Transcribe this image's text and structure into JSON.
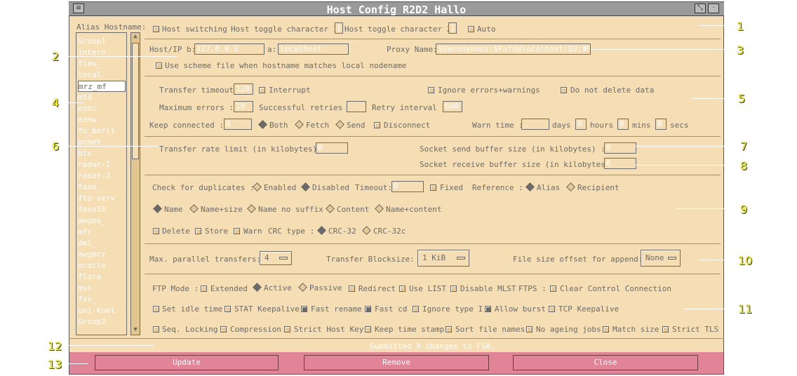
{
  "window": {
    "title": "Host Config R2D2 Hallo"
  },
  "sidebar": {
    "header": "Alias Hostname:",
    "items": [
      "Group1",
      "intern",
      "fiau_",
      "local",
      "mrz_mf",
      "mfd",
      "esoc",
      "ezmw",
      "fu_berl1",
      "pcmet_",
      "btx",
      "radar-1",
      "radar-2",
      "faxe_",
      "ftp-serv",
      "faxe10",
      "awgeo_",
      "mfc",
      "dmi_",
      "awgmrz",
      "oracle",
      "flora",
      "mss",
      "fss_",
      "uni-koel",
      "Group2"
    ],
    "selected_index": 4
  },
  "row1": {
    "host_switching": "Host switching",
    "toggle1_label": "Host toggle character 1:",
    "toggle1_value": "[",
    "toggle2_label": "Host toggle character 2:",
    "toggle2_value": "]",
    "auto": "Auto"
  },
  "row2": {
    "hostip_label": "Host/IP b:",
    "hostip_b": "127.0.0.1",
    "a_label": "a:",
    "hostip_a": "localhost",
    "proxy_label": "Proxy Name:",
    "proxy_value": "$Uanonymous;$Pafd@localhost;$U;$P",
    "scheme_file": "Use scheme file when hostname matches local nodename"
  },
  "transfer": {
    "timeout_label": "Transfer timeout:",
    "timeout_value": "120",
    "interrupt": "Interrupt",
    "ignore_errors": "Ignore errors+warnings",
    "no_delete": "Do not delete data",
    "max_errors_label": "Maximum errors  :",
    "max_errors_value": "10",
    "retries_label": "Successful retries :",
    "retries_value": "",
    "retry_interval_label": "Retry interval :",
    "retry_interval_value": "600",
    "keep_label": "Keep connected  :",
    "keep_value": "0",
    "both": "Both",
    "fetch": "Fetch",
    "send": "Send",
    "disconnect": "Disconnect",
    "warn_label": "Warn time :",
    "warn_days": "",
    "days": "days",
    "warn_hours": "0",
    "hours": "hours",
    "warn_mins": "0",
    "mins": "mins",
    "warn_secs": "0",
    "secs": "secs"
  },
  "rate": {
    "limit_label": "Transfer rate limit (in kilobytes) :",
    "limit_value": "0",
    "send_buf_label": "Socket send buffer size (in kilobytes)    :",
    "send_buf_value": "0",
    "recv_buf_label": "Socket receive buffer size (in kilobytes) :",
    "recv_buf_value": "0"
  },
  "dup": {
    "check_label": "Check for duplicates :",
    "enabled": "Enabled",
    "disabled": "Disabled",
    "timeout_label": "Timeout:",
    "timeout_value": "0",
    "fixed": "Fixed",
    "reference_label": "Reference :",
    "alias": "Alias",
    "recipient": "Recipient",
    "name": "Name",
    "name_size": "Name+size",
    "name_no_suffix": "Name no suffix",
    "content": "Content",
    "name_content": "Name+content",
    "delete": "Delete",
    "store": "Store",
    "warn": "Warn",
    "crc_label": "CRC type :",
    "crc32": "CRC-32",
    "crc32c": "CRC-32c"
  },
  "par": {
    "max_label": "Max. parallel transfers:",
    "max_value": "4",
    "blocksize_label": "Transfer Blocksize:",
    "blocksize_value": "1 KiB",
    "offset_label": "File size offset for append:",
    "offset_value": "None"
  },
  "ftp": {
    "mode_label": "FTP Mode :",
    "extended": "Extended",
    "active": "Active",
    "passive": "Passive",
    "redirect": "Redirect",
    "use_list": "Use LIST",
    "disable_mlst": "Disable MLST",
    "ftps_label": "FTPS :",
    "clear_control": "Clear Control Connection",
    "idle": "Set idle time",
    "stat_keepalive": "STAT Keepalive",
    "fast_rename": "Fast rename",
    "fast_cd": "Fast cd",
    "ignore_type": "Ignore type I",
    "allow_burst": "Allow burst",
    "tcp_keepalive": "TCP Keepalive",
    "seq_locking": "Seq. Locking",
    "compression": "Compression",
    "strict_host_key": "Strict Host Key",
    "keep_time_stamp": "Keep time stamp",
    "sort_file_names": "Sort file names",
    "no_ageing": "No ageing jobs",
    "match_size": "Match size",
    "strict_tls": "Strict TLS"
  },
  "status": "Submitted 8 changes to FSA.",
  "buttons": {
    "update": "Update",
    "remove": "Remove",
    "close": "Close"
  },
  "callouts": [
    "1",
    "2",
    "3",
    "4",
    "5",
    "6",
    "7",
    "8",
    "9",
    "10",
    "11",
    "12",
    "13"
  ]
}
